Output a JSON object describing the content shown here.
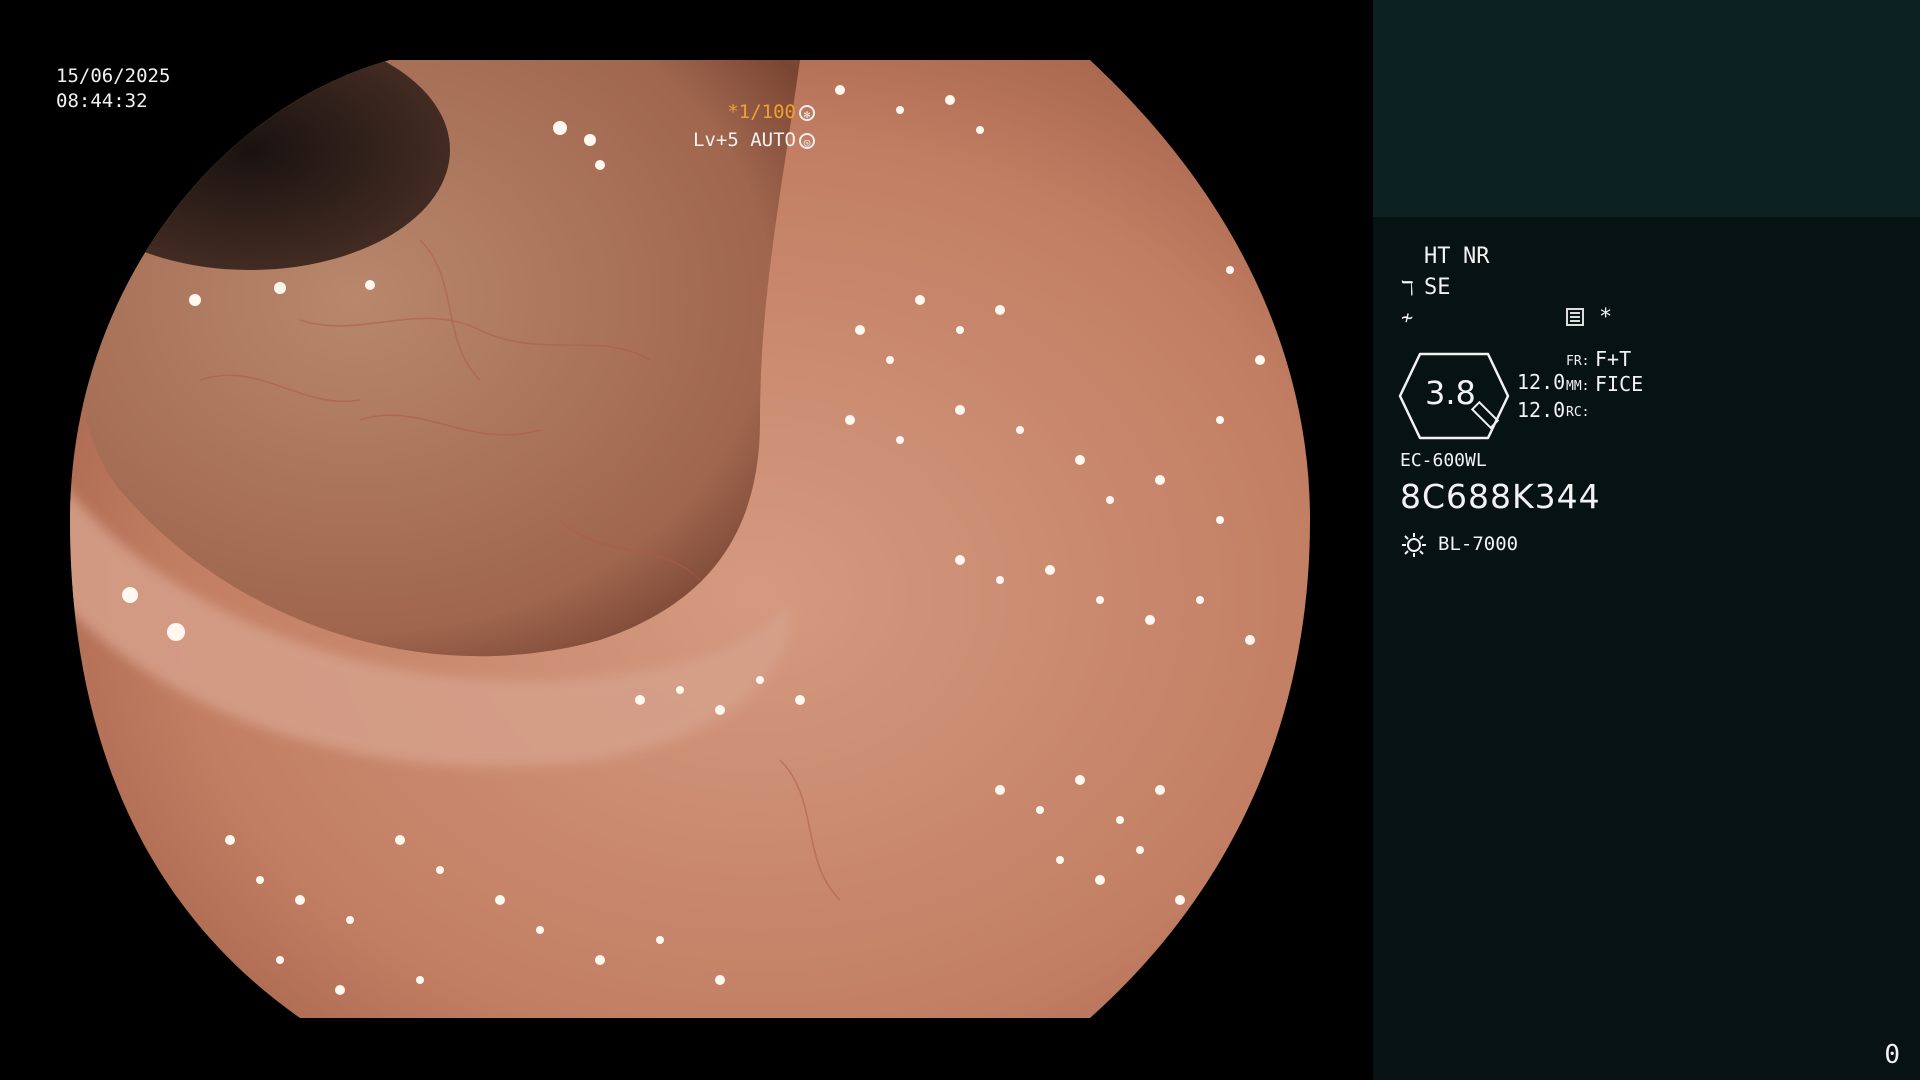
{
  "overlay": {
    "date": "15/06/2025",
    "time": "08:44:32",
    "shutter": "*1/100",
    "level": "Lv+5 AUTO"
  },
  "sidebar": {
    "ht": "HT",
    "nr": "NR",
    "se": "SE",
    "star": "*",
    "zoom": "3.8",
    "value_a": "12.0",
    "value_b": "12.0",
    "fr_label": "FR:",
    "fr_value": "F+T",
    "mm_label": "MM:",
    "mm_value": "FICE",
    "rc_label": "RC:",
    "model": "EC-600WL",
    "serial": "8C688K344",
    "light_source": "BL-7000",
    "counter": "0"
  },
  "icons": {
    "aperture": "aperture-icon",
    "auto": "auto-iris-icon",
    "structure_enhance": "structure-enhance-icon",
    "freeze": "freeze-icon",
    "menu": "menu-icon",
    "light": "light-source-icon"
  },
  "colors": {
    "accent_orange": "#f0a030",
    "sidebar_bg": "#071212",
    "sidebar_top_bg": "#0c2222",
    "tissue": "#c58068"
  }
}
